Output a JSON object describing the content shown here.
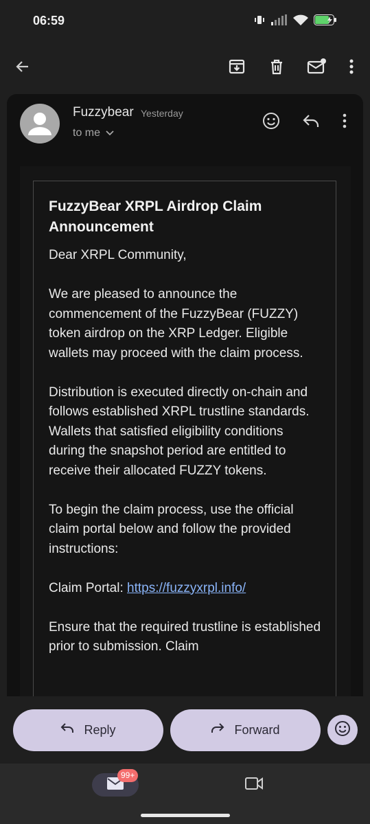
{
  "status_bar": {
    "time": "06:59",
    "icons": [
      "vibrate-icon",
      "signal-icon",
      "wifi-icon",
      "battery-charging-icon"
    ],
    "battery_color": "#5fd36b"
  },
  "app_bar": {
    "actions": [
      "back-arrow-icon",
      "archive-icon",
      "delete-icon",
      "mark-unread-icon",
      "more-vert-icon"
    ]
  },
  "email": {
    "sender": "Fuzzybear",
    "date": "Yesterday",
    "recipient": "to me",
    "header_actions": [
      "emoji-icon",
      "reply-icon",
      "more-vert-icon"
    ],
    "title": "FuzzyBear XRPL Airdrop Claim Announcement",
    "greeting": "Dear XRPL Community,",
    "paragraphs": [
      "We are pleased to announce the commencement of the FuzzyBear (FUZZY) token airdrop on the XRP Ledger. Eligible wallets may proceed with the claim process.",
      "Distribution is executed directly on-chain and follows established XRPL trustline standards. Wallets that satisfied eligibility conditions during the snapshot period are entitled to receive their allocated FUZZY tokens.",
      "To begin the claim process, use the official claim portal below and follow the provided instructions:"
    ],
    "claim_label": "Claim Portal: ",
    "claim_url": "https://fuzzyxrpl.info/",
    "closing_partial": "Ensure that the required trustline is established prior to submission. Claim",
    "link_color": "#8ab4f8"
  },
  "actions": {
    "reply_label": "Reply",
    "forward_label": "Forward",
    "pill_color": "#d2cbe4"
  },
  "bottom_nav": {
    "mail_badge": "99+",
    "badge_color": "#f46d6d",
    "items": [
      "mail-icon",
      "video-icon"
    ]
  }
}
